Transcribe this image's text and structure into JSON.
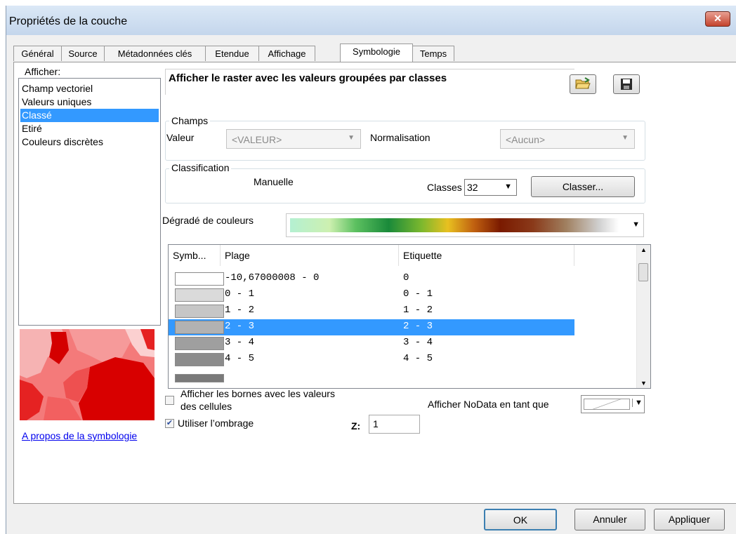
{
  "window": {
    "title": "Propriétés de la couche",
    "close_label": "✕"
  },
  "tabs": [
    {
      "label": "Général"
    },
    {
      "label": "Source"
    },
    {
      "label": "Métadonnées clés"
    },
    {
      "label": "Etendue"
    },
    {
      "label": "Affichage"
    },
    {
      "label": "Symbologie",
      "active": true
    },
    {
      "label": "Temps"
    }
  ],
  "left": {
    "afficher_label": "Afficher:",
    "items": [
      {
        "label": "Champ vectoriel"
      },
      {
        "label": "Valeurs uniques"
      },
      {
        "label": "Classé",
        "selected": true
      },
      {
        "label": "Etiré"
      },
      {
        "label": "Couleurs discrètes"
      }
    ],
    "about_link": "A propos de la symbologie"
  },
  "main": {
    "heading": "Afficher le raster avec les valeurs groupées par classes",
    "champs": {
      "title": "Champs",
      "valeur_label": "Valeur",
      "valeur_value": "<VALEUR>",
      "normalisation_label": "Normalisation",
      "normalisation_value": "<Aucun>"
    },
    "classification": {
      "title": "Classification",
      "method": "Manuelle",
      "classes_label": "Classes",
      "classes_value": "32",
      "classer_button": "Classer..."
    },
    "gradient_label": "Dégradé de couleurs",
    "table": {
      "headers": [
        "Symb...",
        "Plage",
        "Etiquette"
      ],
      "rows": [
        {
          "range": "-10,67000008 - 0",
          "label": "0",
          "color": "#ffffff"
        },
        {
          "range": "0 - 1",
          "label": "0 - 1",
          "color": "#dadada"
        },
        {
          "range": "1 - 2",
          "label": "1 - 2",
          "color": "#c6c6c6"
        },
        {
          "range": "2 - 3",
          "label": "2 - 3",
          "color": "#b2b2b2",
          "selected": true
        },
        {
          "range": "3 - 4",
          "label": "3 - 4",
          "color": "#9f9f9f"
        },
        {
          "range": "4 - 5",
          "label": "4 - 5",
          "color": "#8c8c8c"
        }
      ]
    },
    "show_bounds_line1": "Afficher les bornes avec les valeurs",
    "show_bounds_line2": "des cellules",
    "hillshade_label": "Utiliser l’ombrage",
    "z_label": "Z:",
    "z_value": "1",
    "nodata_label": "Afficher NoData en tant que"
  },
  "footer": {
    "ok": "OK",
    "cancel": "Annuler",
    "apply": "Appliquer"
  }
}
